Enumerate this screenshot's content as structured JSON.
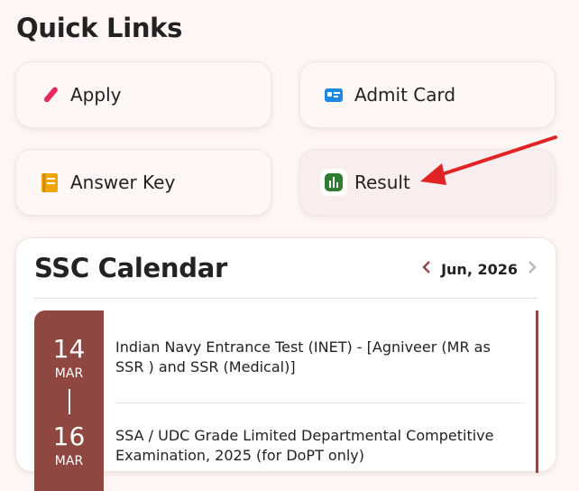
{
  "quick_links": {
    "title": "Quick Links",
    "items": [
      {
        "label": "Apply",
        "icon": "pencil-icon"
      },
      {
        "label": "Admit Card",
        "icon": "id-card-icon"
      },
      {
        "label": "Answer Key",
        "icon": "notebook-icon"
      },
      {
        "label": "Result",
        "icon": "bar-chart-icon"
      }
    ]
  },
  "calendar": {
    "title": "SSC Calendar",
    "month_label": "Jun, 2026",
    "start_day": "14",
    "start_month": "MAR",
    "end_day": "16",
    "end_month": "MAR",
    "events": [
      {
        "text": "Indian Navy Entrance Test (INET) - [Agniveer (MR as SSR ) and SSR (Medical)]"
      },
      {
        "text": "SSA / UDC Grade Limited Departmental Competitive Examination, 2025 (for DoPT only)"
      }
    ]
  },
  "colors": {
    "accent": "#8f4741",
    "arrow": "#e02424",
    "apply_icon": "#e6285d",
    "admit_icon": "#1e88e5",
    "answer_icon": "#f0a500",
    "result_icon": "#2e7d32"
  }
}
